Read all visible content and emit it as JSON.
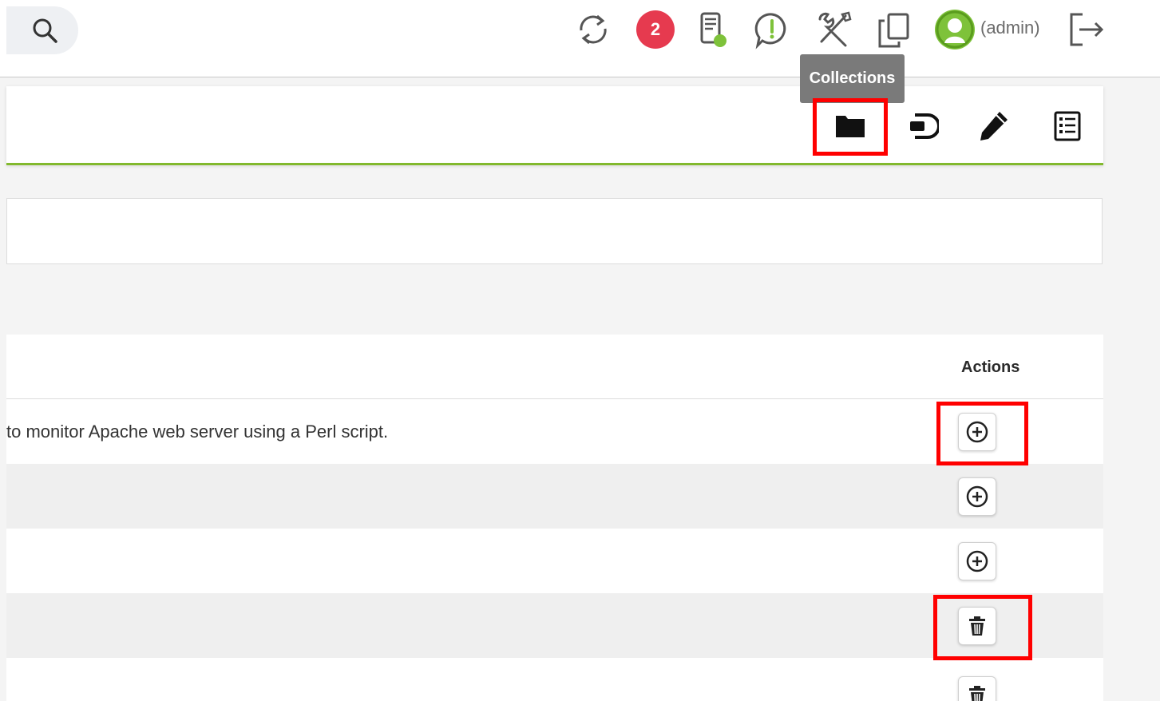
{
  "topbar": {
    "notification_count": "2",
    "user_label": "(admin)",
    "icons": [
      "search-icon",
      "refresh-icon",
      "server-status-icon",
      "alert-icon",
      "tools-icon",
      "copy-icon",
      "user-avatar-icon",
      "logout-icon"
    ]
  },
  "tooltip": {
    "text": "Collections"
  },
  "header_actions": [
    "folder-icon",
    "plugin-icon",
    "pencil-icon",
    "list-icon"
  ],
  "table": {
    "actions_header": "Actions",
    "rows": [
      {
        "description": "to monitor Apache web server using a Perl script.",
        "action": "add"
      },
      {
        "description": "",
        "action": "add"
      },
      {
        "description": "",
        "action": "add"
      },
      {
        "description": "",
        "action": "delete"
      },
      {
        "description": "",
        "action": "delete"
      }
    ]
  },
  "colors": {
    "accent_green": "#82b92e",
    "badge_red": "#e63a4f",
    "highlight_red": "#ff0000",
    "tooltip_gray": "#7a7a7a"
  }
}
